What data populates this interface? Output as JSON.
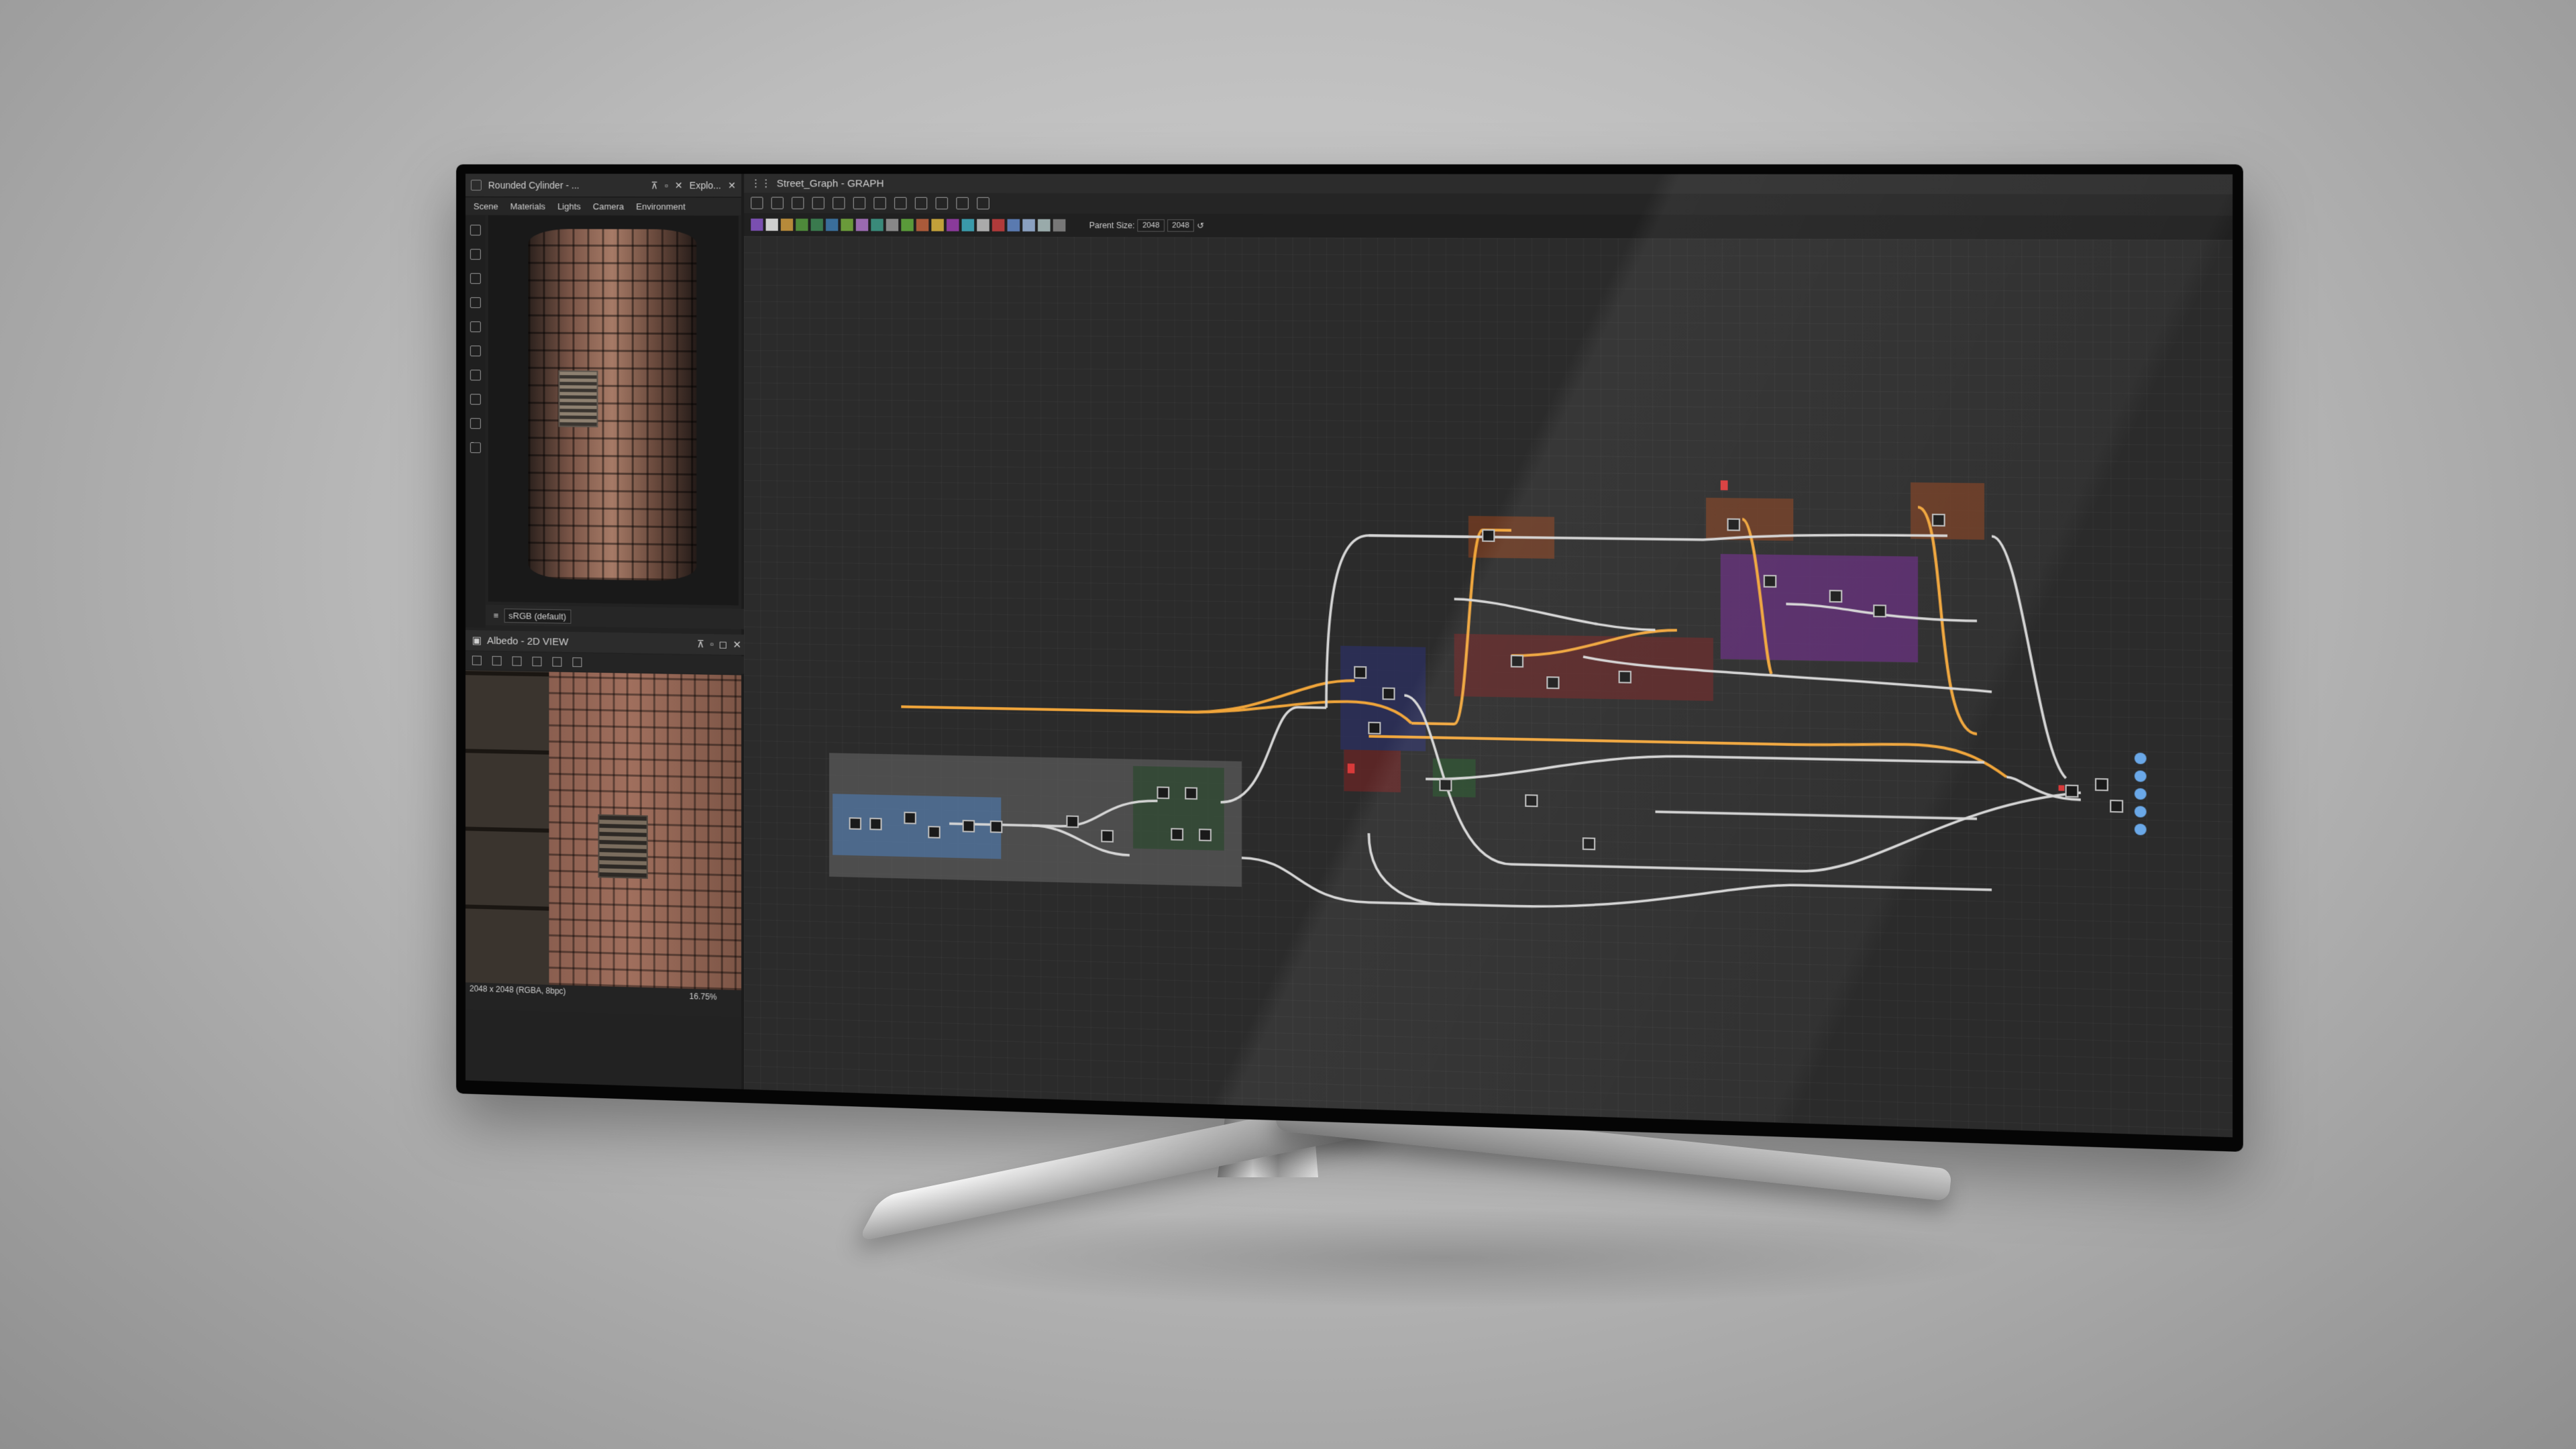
{
  "explorer_tab": {
    "title": "Rounded Cylinder - ...",
    "second_tab": "Explo...",
    "tabs": [
      "Scene",
      "Materials",
      "Lights",
      "Camera",
      "Environment"
    ],
    "colorspace": "sRGB (default)"
  },
  "view2d": {
    "title": "Albedo - 2D VIEW",
    "status_left": "2048 x 2048 (RGBA, 8bpc)",
    "zoom": "16.75%"
  },
  "graph": {
    "title": "Street_Graph - GRAPH",
    "parent_size_label": "Parent Size:",
    "parent_size_value": "2048",
    "size_value": "2048"
  },
  "colors": {
    "frame_orange": "#6b3a22",
    "frame_purple": "#5a2a6e",
    "frame_red": "#5e2626",
    "frame_blue": "#2b2f5a",
    "frame_green": "#27482a",
    "frame_gray": "#5a5a5a",
    "frame_lightblue": "#4d6f96",
    "wire_white": "#d6d6d6",
    "wire_orange": "#f0a53a"
  }
}
